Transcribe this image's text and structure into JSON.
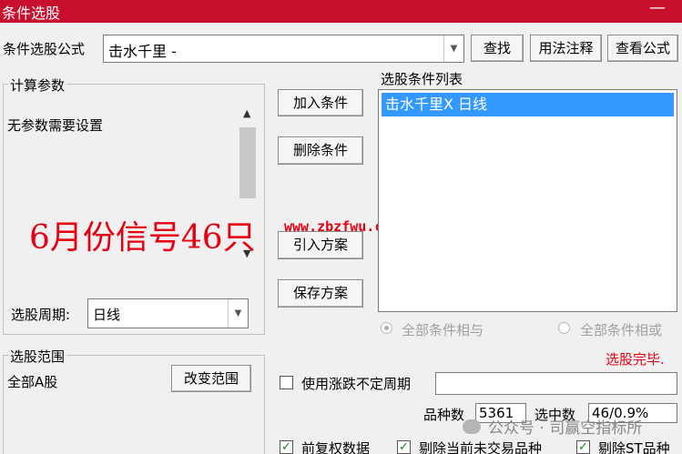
{
  "window": {
    "title": "条件选股",
    "minimize": "—"
  },
  "formula": {
    "label": "条件选股公式",
    "value": "击水千里 -"
  },
  "buttons": {
    "find": "查找",
    "usage": "用法注释",
    "view_formula": "查看公式",
    "add_condition": "加入条件",
    "delete_condition": "删除条件",
    "import_plan": "引入方案",
    "save_plan": "保存方案",
    "change_range": "改变范围"
  },
  "params": {
    "group_title": "计算参数",
    "message": "无参数需要设置",
    "period_label": "选股周期:",
    "period_value": "日线"
  },
  "conditions": {
    "list_label": "选股条件列表",
    "items": [
      "击水千里X  日线"
    ],
    "logic_and": "全部条件相与",
    "logic_or": "全部条件相或",
    "status": "选股完毕.",
    "status_color": "#e60012"
  },
  "range": {
    "group_title": "选股范围",
    "value": "全部A股"
  },
  "uncertain_period": {
    "label": "使用涨跌不定周期",
    "checked": false
  },
  "stats": {
    "count_label": "品种数",
    "count_value": "5361",
    "selected_label": "选中数",
    "selected_value": "46/0.9%"
  },
  "options": [
    {
      "label": "前复权数据",
      "checked": true
    },
    {
      "label": "剔除当前未交易品种",
      "checked": true
    },
    {
      "label": "剔除ST品种",
      "checked": true
    }
  ],
  "overlay": {
    "headline": "6月份信号46只",
    "url": "www.zbzfwu.com",
    "watermark": "公众号 · 司赢空指标所"
  }
}
